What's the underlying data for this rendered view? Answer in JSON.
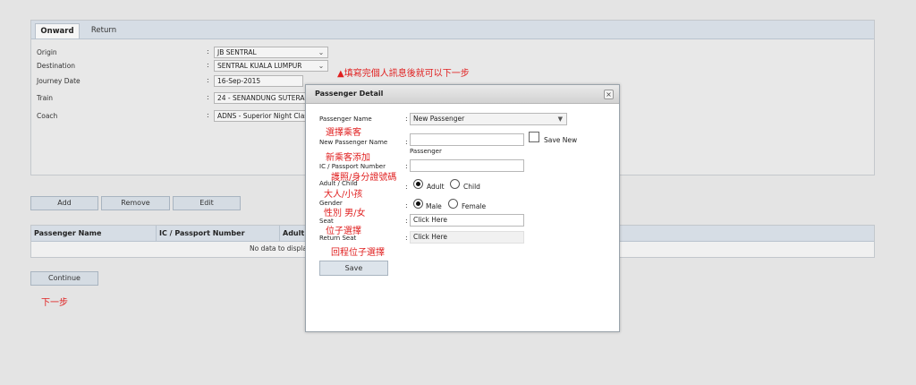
{
  "tabs": {
    "onward": "Onward",
    "return": "Return"
  },
  "journey": {
    "origin_label": "Origin",
    "origin_value": "JB SENTRAL",
    "destination_label": "Destination",
    "destination_value": "SENTRAL KUALA LUMPUR",
    "date_label": "Journey Date",
    "date_value": "16-Sep-2015",
    "train_label": "Train",
    "train_value": "24 - SENANDUNG SUTERA",
    "coach_label": "Coach",
    "coach_value": "ADNS - Superior Night Class"
  },
  "buttons": {
    "add": "Add",
    "remove": "Remove",
    "edit": "Edit",
    "continue": "Continue"
  },
  "grid": {
    "columns": [
      "Passenger Name",
      "IC / Passport Number",
      "Adult /"
    ],
    "empty_text": "No data to display"
  },
  "annotations": {
    "fill_info": "▲填寫完個人訊息後就可以下一步",
    "next_step": "下一步",
    "choose_passenger": "選擇乘客",
    "add_passenger": "新乘客添加",
    "passport": "護照/身分證號碼",
    "adult_child": "大人/小孩",
    "gender": "性別 男/女",
    "seat": "位子選擇",
    "return_seat": "回程位子選擇"
  },
  "dialog": {
    "title": "Passenger Detail",
    "close_glyph": "×",
    "passenger_name_label": "Passenger Name",
    "passenger_name_value": "New Passenger",
    "new_passenger_label": "New Passenger Name",
    "new_passenger_value": "",
    "save_new_label": "Save New",
    "passenger_caption": "Passenger",
    "ic_label": "IC / Passport Number",
    "ic_value": "",
    "adult_child_label": "Adult / Child",
    "adult_label": "Adult",
    "child_label": "Child",
    "gender_label": "Gender",
    "male_label": "Male",
    "female_label": "Female",
    "seat_label": "Seat",
    "seat_value": "Click Here",
    "return_seat_label": "Return Seat",
    "return_seat_value": "Click Here",
    "save_button": "Save",
    "colon": ":"
  },
  "colors": {
    "annotation_red": "#e02020",
    "header_blue": "#d6dde5"
  }
}
